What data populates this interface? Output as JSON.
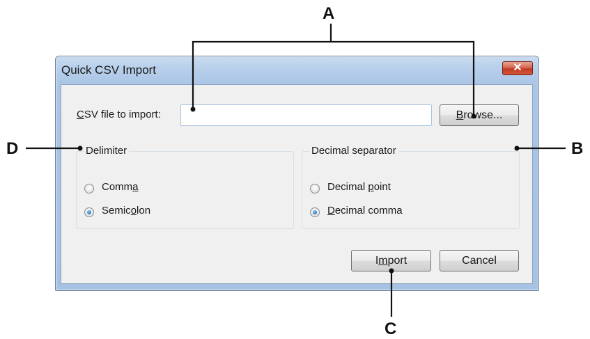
{
  "window": {
    "title": "Quick CSV Import",
    "close_glyph": "✕"
  },
  "file_row": {
    "label_accel": "C",
    "label_rest": "SV file to import:",
    "input_value": "",
    "browse_accel": "B",
    "browse_rest": "rowse..."
  },
  "delimiter": {
    "legend": "Delimiter",
    "options": [
      {
        "pre": "Comm",
        "accel": "a",
        "post": "",
        "checked": false
      },
      {
        "pre": "Semic",
        "accel": "o",
        "post": "lon",
        "checked": true
      }
    ]
  },
  "decimal": {
    "legend": "Decimal separator",
    "options": [
      {
        "pre": "Decimal ",
        "accel": "p",
        "post": "oint",
        "checked": false
      },
      {
        "pre": "",
        "accel": "D",
        "post": "ecimal comma",
        "checked": true
      }
    ]
  },
  "buttons": {
    "import_pre": "I",
    "import_accel": "m",
    "import_post": "port",
    "cancel": "Cancel"
  },
  "callouts": {
    "a": "A",
    "b": "B",
    "c": "C",
    "d": "D"
  },
  "colors": {
    "title_gradient": "#b7cfea",
    "close_red": "#c13b22",
    "client_bg": "#f0f0f0",
    "radio_selected": "#2a7dc6"
  }
}
